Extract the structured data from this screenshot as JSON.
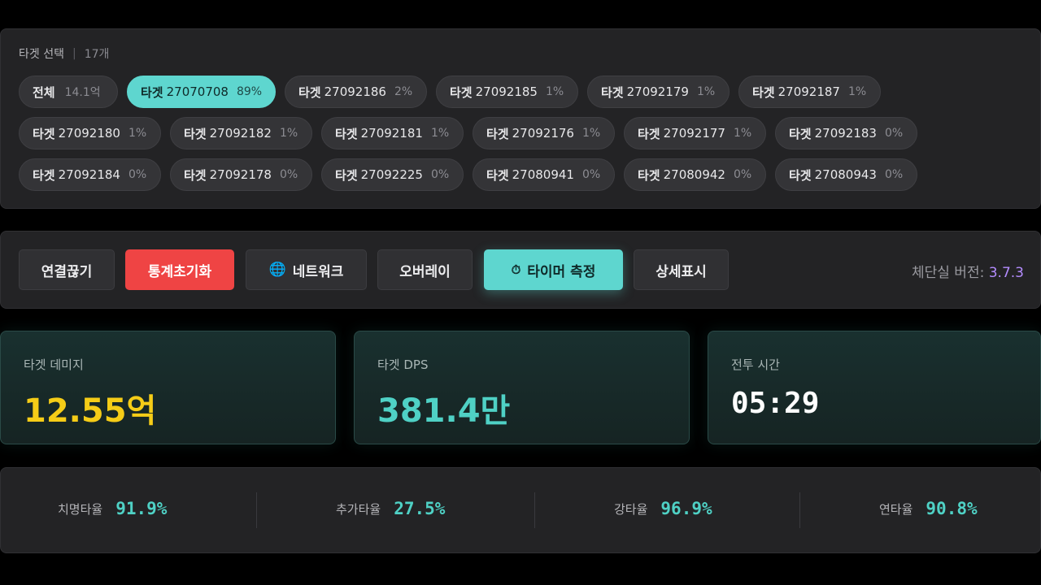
{
  "targets": {
    "header_label": "타겟 선택",
    "count": "17개",
    "chip_prefix": "타겟",
    "all_chip": {
      "label": "전체",
      "value": "14.1억"
    },
    "rows": [
      [
        {
          "id": "27070708",
          "pct": "89%",
          "active": true
        },
        {
          "id": "27092186",
          "pct": "2%"
        },
        {
          "id": "27092185",
          "pct": "1%"
        },
        {
          "id": "27092179",
          "pct": "1%"
        },
        {
          "id": "27092187",
          "pct": "1%"
        }
      ],
      [
        {
          "id": "27092180",
          "pct": "1%"
        },
        {
          "id": "27092182",
          "pct": "1%"
        },
        {
          "id": "27092181",
          "pct": "1%"
        },
        {
          "id": "27092176",
          "pct": "1%"
        },
        {
          "id": "27092177",
          "pct": "1%"
        },
        {
          "id": "27092183",
          "pct": "0%"
        }
      ],
      [
        {
          "id": "27092184",
          "pct": "0%"
        },
        {
          "id": "27092178",
          "pct": "0%"
        },
        {
          "id": "27092225",
          "pct": "0%"
        },
        {
          "id": "27080941",
          "pct": "0%"
        },
        {
          "id": "27080942",
          "pct": "0%"
        },
        {
          "id": "27080943",
          "pct": "0%"
        }
      ]
    ]
  },
  "toolbar": {
    "disconnect": "연결끊기",
    "reset_stats": "통계초기화",
    "network": "네트워크",
    "overlay": "오버레이",
    "timer": "타이머 측정",
    "details": "상세표시",
    "version_label": "체단실 버전:",
    "version": "3.7.3"
  },
  "stats": {
    "damage_label": "타겟 데미지",
    "damage_value": "12.55억",
    "dps_label": "타겟 DPS",
    "dps_value": "381.4만",
    "time_label": "전투 시간",
    "time_value": "05:29"
  },
  "rates": {
    "crit_label": "치명타율",
    "crit_value": "91.9%",
    "extra_label": "추가타율",
    "extra_value": "27.5%",
    "strong_label": "강타율",
    "strong_value": "96.9%",
    "combo_label": "연타율",
    "combo_value": "90.8%"
  },
  "colors": {
    "accent_teal": "#5ed6cf",
    "danger_red": "#ef4444",
    "gold": "#f5cc17",
    "version_purple": "#b48cff"
  }
}
